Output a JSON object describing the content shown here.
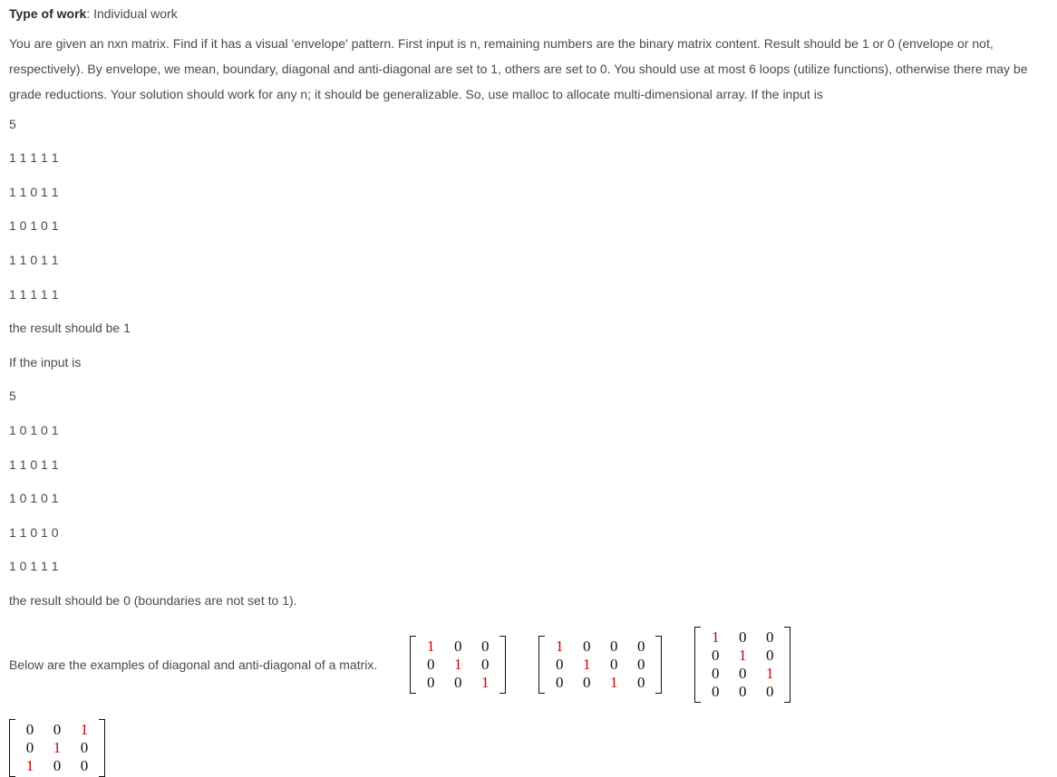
{
  "type_label": "Type of work",
  "type_value": ": Individual work",
  "para1": "You are given an nxn matrix. Find if it has a visual 'envelope' pattern. First input is n, remaining numbers are the binary matrix content. Result should be 1 or 0 (envelope or not, respectively). By envelope, we mean, boundary, diagonal and anti-diagonal are set to 1, others are set to 0. You should use at most 6 loops (utilize functions), otherwise there may be grade reductions. Your solution should work for any n; it should be generalizable. So, use malloc to allocate multi-dimensional array. If the input is",
  "example1": {
    "n": "5",
    "rows": [
      "1 1 1 1 1",
      "1 1 0 1 1",
      "1 0 1 0 1",
      "1 1 0 1 1",
      "1 1 1 1 1"
    ],
    "result": "the result should be 1"
  },
  "between": "If the input is",
  "example2": {
    "n": "5",
    "rows": [
      "1 0 1 0 1",
      "1 1 0 1 1",
      "1 0 1 0 1",
      "1 1 0 1 0",
      "1 0 1 1 1"
    ],
    "result": "the result should be 0 (boundaries are not set to 1)."
  },
  "matrix_lead": "Below are the examples of diagonal and anti-diagonal of a matrix.",
  "matrices": {
    "m_a": {
      "rows": [
        [
          {
            "v": "1",
            "hl": true
          },
          {
            "v": "0"
          },
          {
            "v": "0"
          }
        ],
        [
          {
            "v": "0"
          },
          {
            "v": "1",
            "hl": true
          },
          {
            "v": "0"
          }
        ],
        [
          {
            "v": "0"
          },
          {
            "v": "0"
          },
          {
            "v": "1",
            "hl": true
          }
        ]
      ]
    },
    "m_b": {
      "rows": [
        [
          {
            "v": "1",
            "hl": true
          },
          {
            "v": "0"
          },
          {
            "v": "0"
          },
          {
            "v": "0"
          }
        ],
        [
          {
            "v": "0"
          },
          {
            "v": "1",
            "hl": true
          },
          {
            "v": "0"
          },
          {
            "v": "0"
          }
        ],
        [
          {
            "v": "0"
          },
          {
            "v": "0"
          },
          {
            "v": "1",
            "hl": true
          },
          {
            "v": "0"
          }
        ]
      ]
    },
    "m_c": {
      "rows": [
        [
          {
            "v": "1",
            "hl": true
          },
          {
            "v": "0"
          },
          {
            "v": "0"
          }
        ],
        [
          {
            "v": "0"
          },
          {
            "v": "1",
            "hl": true
          },
          {
            "v": "0"
          }
        ],
        [
          {
            "v": "0"
          },
          {
            "v": "0"
          },
          {
            "v": "1",
            "hl": true
          }
        ],
        [
          {
            "v": "0"
          },
          {
            "v": "0"
          },
          {
            "v": "0"
          }
        ]
      ]
    },
    "m_d": {
      "rows": [
        [
          {
            "v": "0"
          },
          {
            "v": "0"
          },
          {
            "v": "1",
            "hl": true
          }
        ],
        [
          {
            "v": "0"
          },
          {
            "v": "1",
            "hl": true
          },
          {
            "v": "0"
          }
        ],
        [
          {
            "v": "1",
            "hl": true
          },
          {
            "v": "0"
          },
          {
            "v": "0"
          }
        ]
      ]
    }
  }
}
